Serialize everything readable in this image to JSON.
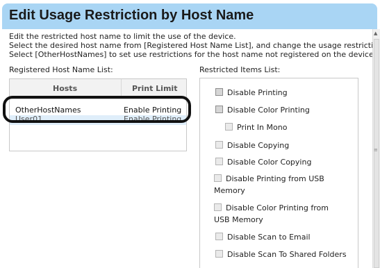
{
  "header": {
    "title": "Edit Usage Restriction by Host Name"
  },
  "description": [
    "Edit the restricted host name to limit the use of the device.",
    "Select the desired host name from [Registered Host Name List], and change the usage restriction.",
    "Select [OtherHostNames] to set use restrictions for the host name not registered on the device."
  ],
  "registered": {
    "label": "Registered Host Name List:",
    "columns": [
      "Hosts",
      "Print Limit"
    ],
    "rows": [
      {
        "host": "OtherHostNames",
        "limit": "Enable Printing"
      },
      {
        "host": "User01",
        "limit": "Enable Printing"
      }
    ]
  },
  "restricted": {
    "label": "Restricted Items List:",
    "items": [
      "Disable Printing",
      "Disable Color Printing",
      "Print In Mono",
      "Disable Copying",
      "Disable Color Copying",
      "Disable Printing from USB",
      "Memory",
      "Disable Color Printing from",
      "USB Memory",
      "Disable Scan to Email",
      "Disable Scan To Shared Folders"
    ]
  },
  "colors": {
    "title_bg": "#a9d5f4",
    "selected_row": "#dfeefa",
    "highlight": "#111111"
  },
  "icons": {
    "scroll_up": "scroll-up-arrow-icon",
    "checkbox": "checkbox-icon"
  }
}
